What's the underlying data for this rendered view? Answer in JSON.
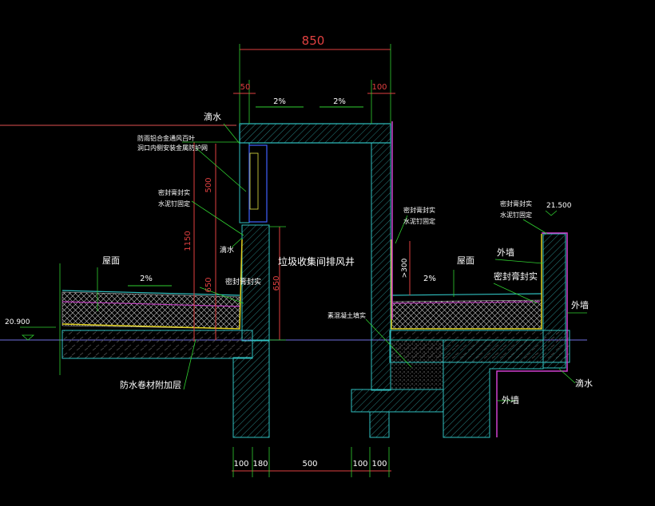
{
  "dimensions": {
    "top_total": "850",
    "top_left": "50",
    "top_right": "100",
    "left_vertical_1150": "1150",
    "left_vertical_500": "500",
    "left_vertical_650": "650",
    "middle_vertical_650": "650",
    "right_300": ">300",
    "bottom": [
      "100",
      "180",
      "500",
      "100",
      "100"
    ]
  },
  "slopes": {
    "top_left": "2%",
    "top_right": "2%",
    "roof_left": "2%",
    "roof_right": "2%"
  },
  "labels": {
    "drip_top": "滴水",
    "louver_note_line1": "防雨铝合金通风百叶",
    "louver_note_line2": "洞口内侧安装金属防护网",
    "seal_left_line1": "密封膏封实",
    "seal_left_line2": "水泥钉固定",
    "drip_left": "滴水",
    "roof_left": "屋面",
    "shaft": "垃圾收集间排风井",
    "seal_mid_line1": "密封膏封实",
    "seal_mid_line2": "水泥钉固定",
    "roof_right": "屋面",
    "seal_strip": "密封膏封实",
    "seal_right_line1": "密封膏封实",
    "seal_right_line2": "水泥钉固定",
    "elev_right": "21.500",
    "ext_wall_1": "外墙",
    "ext_wall_2": "外墙",
    "ext_wall_3": "外墙",
    "drip_right": "滴水",
    "concrete": "素混凝土填实",
    "elev_left": "20.900",
    "waterproof": "防水卷材附加层"
  },
  "colors": {
    "background": "#000000",
    "structure_cyan": "#30c0c0",
    "dimension_red": "#e04040",
    "extension_green": "#30d030",
    "membrane_magenta": "#d040d0",
    "membrane_yellow": "#e0d020",
    "louver_blue": "#4060ff"
  }
}
